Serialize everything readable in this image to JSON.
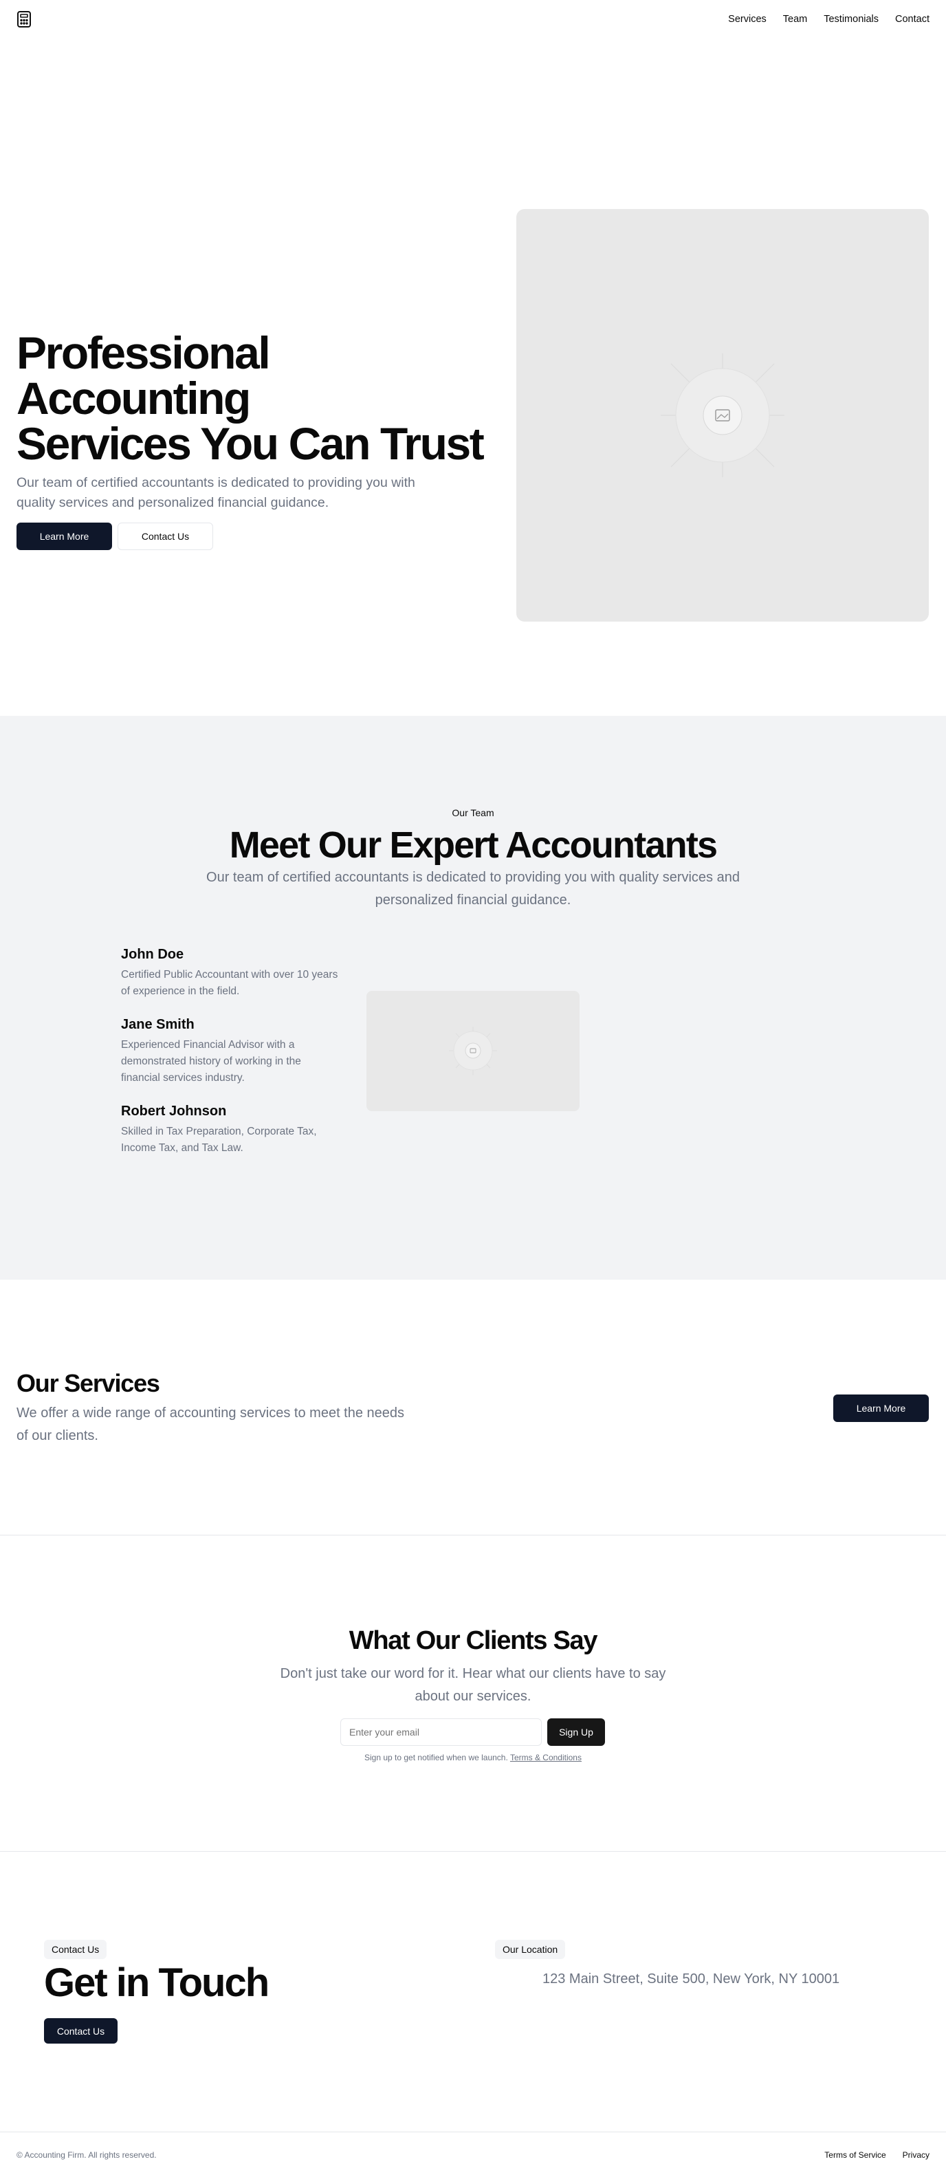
{
  "header": {
    "logo_icon": "calculator-icon",
    "nav": [
      "Services",
      "Team",
      "Testimonials",
      "Contact"
    ]
  },
  "hero": {
    "title_line1": "Professional Accounting",
    "title_line2": "Services You Can Trust",
    "subtitle": "Our team of certified accountants is dedicated to providing you with quality services and personalized financial guidance.",
    "primary_button": "Learn More",
    "secondary_button": "Contact Us",
    "image_icon": "image-placeholder-icon"
  },
  "team": {
    "tag": "Our Team",
    "title": "Meet Our Expert Accountants",
    "subtitle": "Our team of certified accountants is dedicated to providing you with quality services and personalized financial guidance.",
    "members": [
      {
        "name": "John Doe",
        "description": "Certified Public Accountant with over 10 years of experience in the field."
      },
      {
        "name": "Jane Smith",
        "description": "Experienced Financial Advisor with a demonstrated history of working in the financial services industry."
      },
      {
        "name": "Robert Johnson",
        "description": "Skilled in Tax Preparation, Corporate Tax, Income Tax, and Tax Law."
      }
    ]
  },
  "services": {
    "title": "Our Services",
    "subtitle": "We offer a wide range of accounting services to meet the needs of our clients.",
    "button": "Learn More"
  },
  "testimonials": {
    "title": "What Our Clients Say",
    "subtitle": "Don't just take our word for it. Hear what our clients have to say about our services.",
    "email_placeholder": "Enter your email",
    "signup_button": "Sign Up",
    "note": "Sign up to get notified when we launch.",
    "terms_link": "Terms & Conditions"
  },
  "contact": {
    "tag": "Contact Us",
    "title": "Get in Touch",
    "button": "Contact Us",
    "location_tag": "Our Location",
    "address": "123 Main Street, Suite 500, New York, NY 10001"
  },
  "footer": {
    "copyright": "© Accounting Firm. All rights reserved.",
    "links": [
      "Terms of Service",
      "Privacy"
    ]
  },
  "colors": {
    "primary_button": "#0f172a",
    "section_gray": "#f2f3f5",
    "placeholder_gray": "#e8e8e8",
    "muted_text": "#6b7280"
  }
}
